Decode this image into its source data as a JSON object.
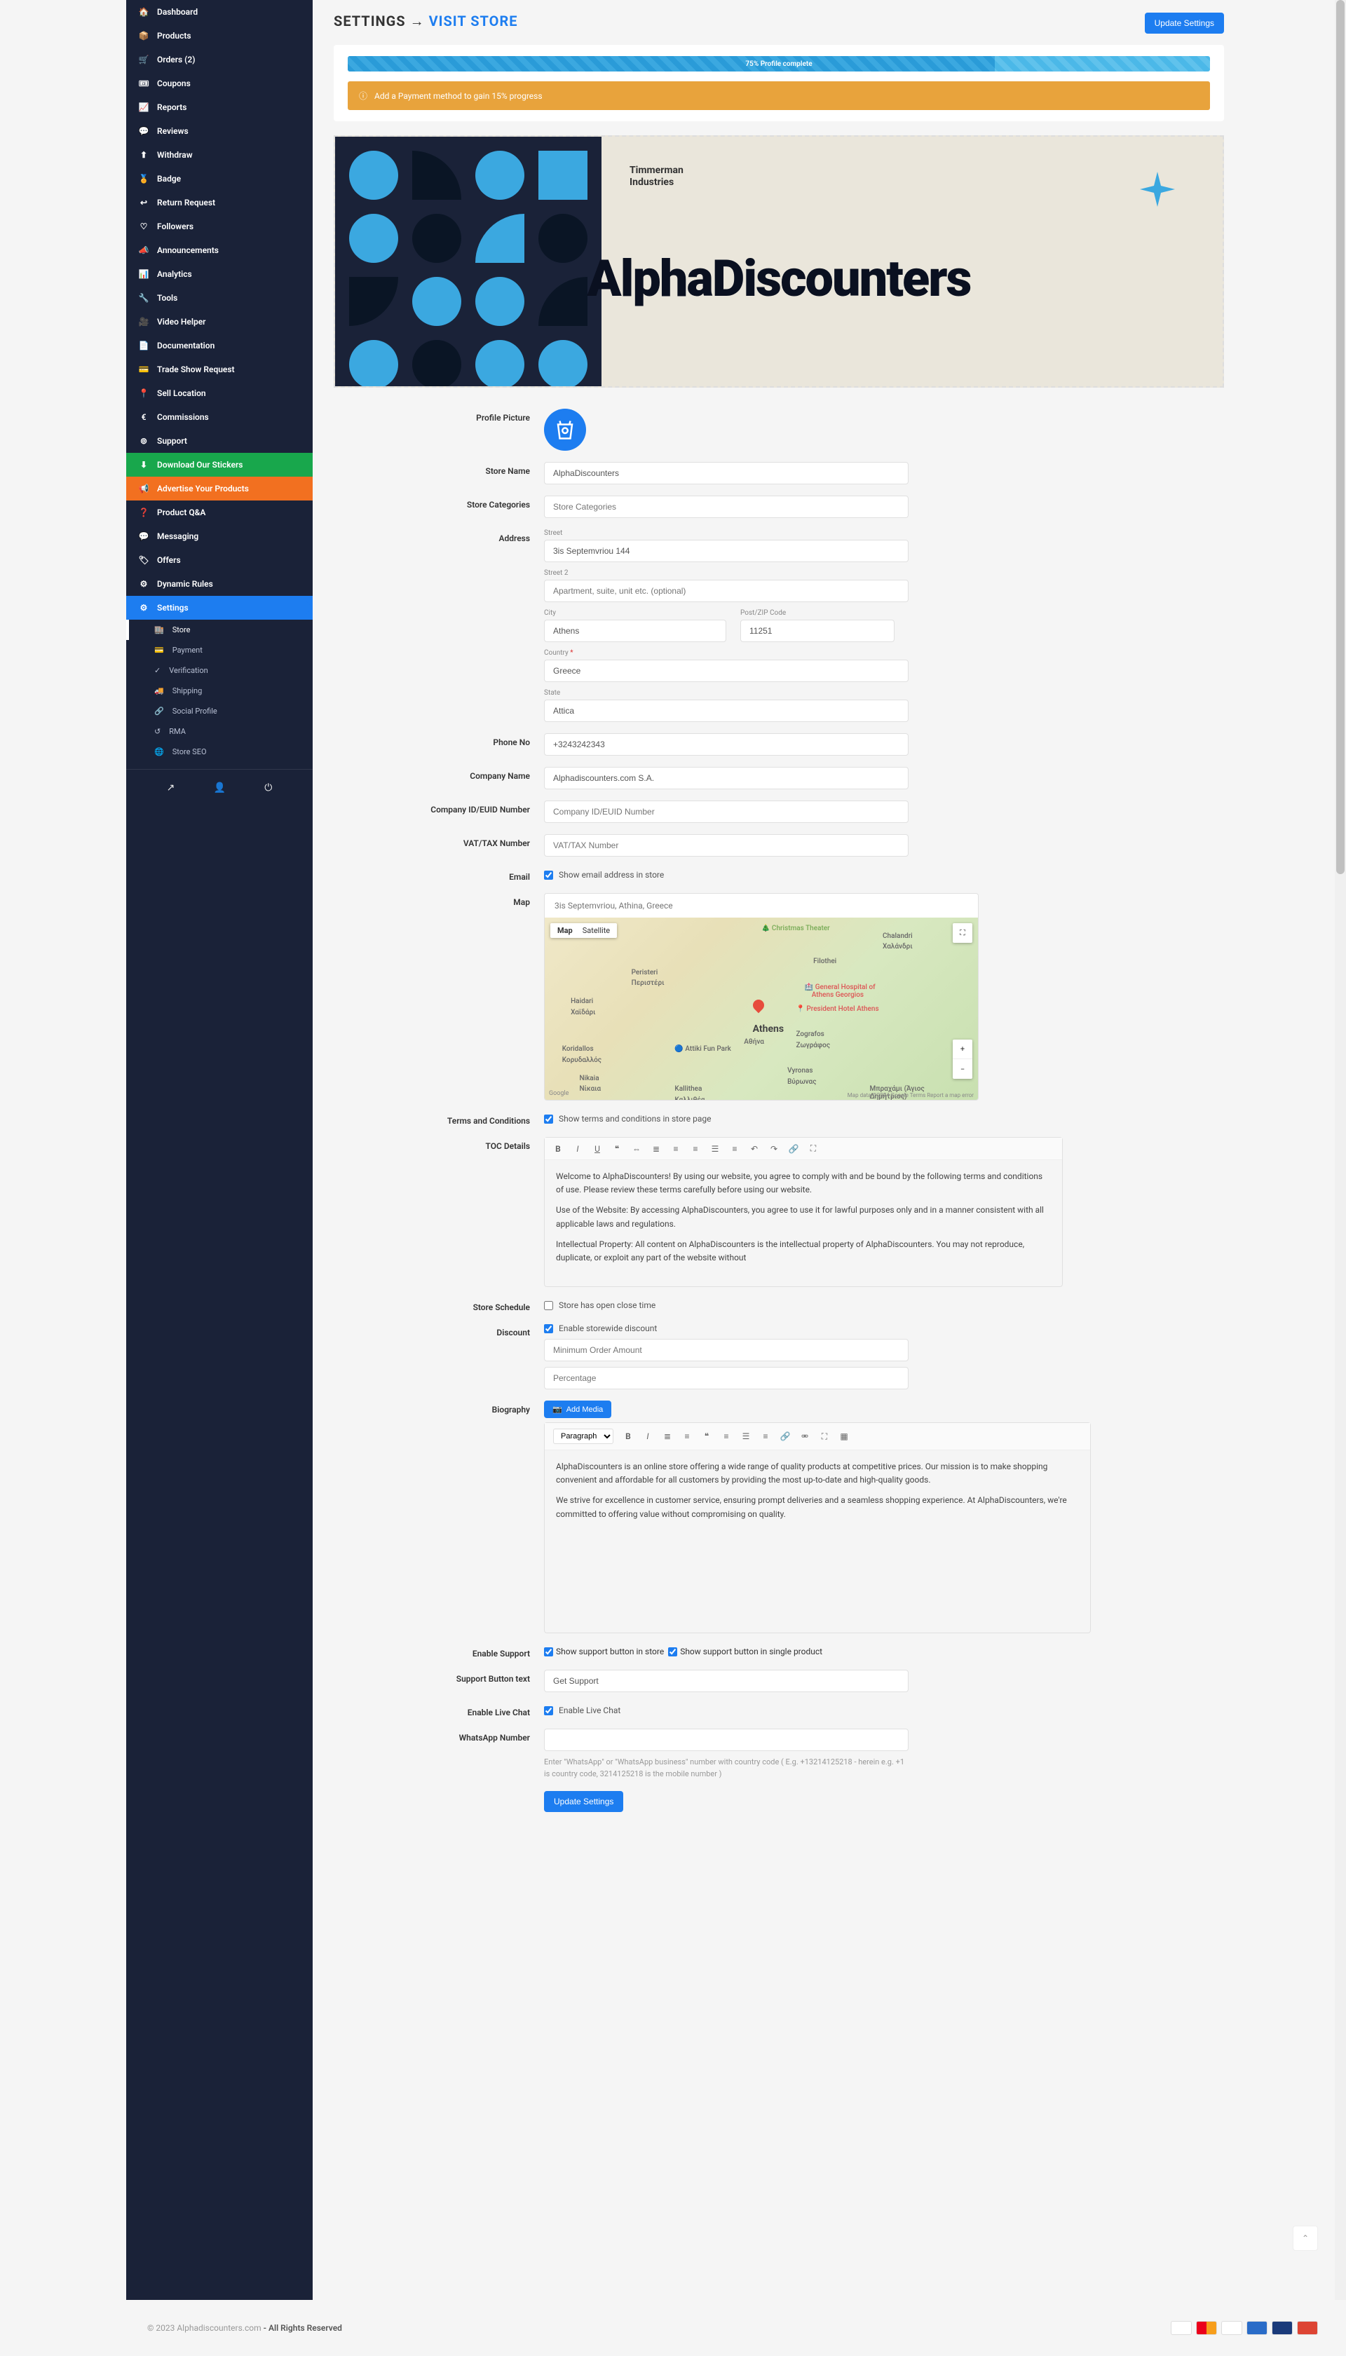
{
  "breadcrumb": {
    "part1": "SETTINGS",
    "arrow": "→",
    "part2": "VISIT STORE"
  },
  "buttons": {
    "update_settings": "Update Settings",
    "add_media": "Add Media",
    "get_support": "Get Support"
  },
  "progress": {
    "text": "75% Profile complete"
  },
  "notice": {
    "text": "Add a Payment method  to gain 15% progress"
  },
  "banner": {
    "company_line1": "Timmerman",
    "company_line2": "Industries",
    "title": "AlphaDiscounters"
  },
  "sidebar": [
    {
      "icon": "tachometer",
      "label": "Dashboard"
    },
    {
      "icon": "box",
      "label": "Products"
    },
    {
      "icon": "cart",
      "label": "Orders (2)"
    },
    {
      "icon": "ticket",
      "label": "Coupons"
    },
    {
      "icon": "chart",
      "label": "Reports"
    },
    {
      "icon": "comment",
      "label": "Reviews"
    },
    {
      "icon": "upload",
      "label": "Withdraw"
    },
    {
      "icon": "badge",
      "label": "Badge"
    },
    {
      "icon": "undo",
      "label": "Return Request"
    },
    {
      "icon": "heart",
      "label": "Followers"
    },
    {
      "icon": "bullhorn",
      "label": "Announcements"
    },
    {
      "icon": "analytics",
      "label": "Analytics"
    },
    {
      "icon": "wrench",
      "label": "Tools"
    },
    {
      "icon": "video",
      "label": "Video Helper"
    },
    {
      "icon": "file",
      "label": "Documentation"
    },
    {
      "icon": "card",
      "label": "Trade Show Request"
    },
    {
      "icon": "pin",
      "label": "Sell Location"
    },
    {
      "icon": "euro",
      "label": "Commissions"
    },
    {
      "icon": "life-ring",
      "label": "Support"
    },
    {
      "icon": "download",
      "label": "Download Our Stickers",
      "cls": "side-green"
    },
    {
      "icon": "megaphone",
      "label": "Advertise Your Products",
      "cls": "side-orange"
    },
    {
      "icon": "question",
      "label": "Product Q&A"
    },
    {
      "icon": "chat",
      "label": "Messaging"
    },
    {
      "icon": "tag",
      "label": "Offers"
    },
    {
      "icon": "rules",
      "label": "Dynamic Rules"
    },
    {
      "icon": "cog",
      "label": "Settings",
      "cls": "side-blue"
    }
  ],
  "subnav": [
    {
      "icon": "store",
      "label": "Store",
      "active": true
    },
    {
      "icon": "card",
      "label": "Payment"
    },
    {
      "icon": "check",
      "label": "Verification"
    },
    {
      "icon": "truck",
      "label": "Shipping"
    },
    {
      "icon": "share",
      "label": "Social Profile"
    },
    {
      "icon": "rma",
      "label": "RMA"
    },
    {
      "icon": "seo",
      "label": "Store SEO"
    }
  ],
  "labels": {
    "profile_picture": "Profile Picture",
    "store_name": "Store Name",
    "store_categories": "Store Categories",
    "address": "Address",
    "street": "Street",
    "street2": "Street 2",
    "city": "City",
    "post": "Post/ZIP Code",
    "country": "Country",
    "state": "State",
    "phone": "Phone No",
    "company_name": "Company Name",
    "company_id": "Company ID/EUID Number",
    "vat": "VAT/TAX Number",
    "email": "Email",
    "map": "Map",
    "terms": "Terms and Conditions",
    "toc": "TOC Details",
    "schedule": "Store Schedule",
    "discount": "Discount",
    "biography": "Biography",
    "enable_support": "Enable Support",
    "support_btn_text": "Support Button text",
    "enable_live_chat": "Enable Live Chat",
    "whatsapp": "WhatsApp Number"
  },
  "values": {
    "store_name": "AlphaDiscounters",
    "street": "3is Septemvriou 144",
    "city": "Athens",
    "post": "11251",
    "country": "Greece",
    "state": "Attica",
    "phone": "+3243242343",
    "company_name": "Alphadiscounters.com S.A.",
    "map_search": "3is Septemvriou, Athina, Greece"
  },
  "placeholders": {
    "store_categories": "Store Categories",
    "street2": "Apartment, suite, unit etc. (optional)",
    "company_id": "Company ID/EUID Number",
    "vat": "VAT/TAX Number",
    "min_order": "Minimum Order Amount",
    "percentage": "Percentage",
    "paragraph": "Paragraph"
  },
  "checkboxes": {
    "show_email": "Show email address in store",
    "show_terms": "Show terms and conditions in store page",
    "open_close": "Store has open close time",
    "enable_discount": "Enable storewide discount",
    "support_store": "Show support button in store",
    "support_single": "Show support button in single product",
    "live_chat": "Enable Live Chat"
  },
  "map": {
    "tab_map": "Map",
    "tab_sat": "Satellite",
    "places": [
      "Christmas Theater",
      "Chalandri",
      "Χαλάνδρι",
      "Μπραχάμι (Άγιος Δημήτριος)",
      "Kallithea",
      "Καλλιθέα",
      "Nikaia",
      "Νίκαια",
      "Koridallos",
      "Κορυδαλλός",
      "Peristeri",
      "Περιστέρι",
      "Haidari",
      "Χαϊδάρι",
      "Αθήνα",
      "Athens",
      "Filothei",
      "Zografos",
      "Ζωγράφος",
      "Vyronas",
      "Βύρωνας",
      "Attiki Fun Park",
      "General Hospital of Athens Georgios",
      "President Hotel Athens"
    ],
    "attrib": "Map data ©2024 Google   Terms   Report a map error"
  },
  "toc_body": {
    "p1": "Welcome to AlphaDiscounters! By using our website, you agree to comply with and be bound by the following terms and conditions of use. Please review these terms carefully before using our website.",
    "p2": "Use of the Website: By accessing AlphaDiscounters, you agree to use it for lawful purposes only and in a manner consistent with all applicable laws and regulations.",
    "p3": "Intellectual Property: All content on AlphaDiscounters is the intellectual property of AlphaDiscounters. You may not reproduce, duplicate, or exploit any part of the website without"
  },
  "bio_body": {
    "p1": "AlphaDiscounters is an online store offering a wide range of quality products at competitive prices. Our mission is to make shopping convenient and affordable for all customers by providing the most up-to-date and high-quality goods.",
    "p2": "We strive for excellence in customer service, ensuring prompt deliveries and a seamless shopping experience. At AlphaDiscounters, we're committed to offering value without compromising on quality."
  },
  "whatsapp_help": "Enter \"WhatsApp\" or \"WhatsApp business\" number with country code ( E.g. +13214125218 - herein e.g. +1 is country code, 3214125218 is the mobile number )",
  "footer": {
    "copy1": "© 2023 Alphadiscounters.com",
    "copy2": " - All Rights Reserved"
  }
}
